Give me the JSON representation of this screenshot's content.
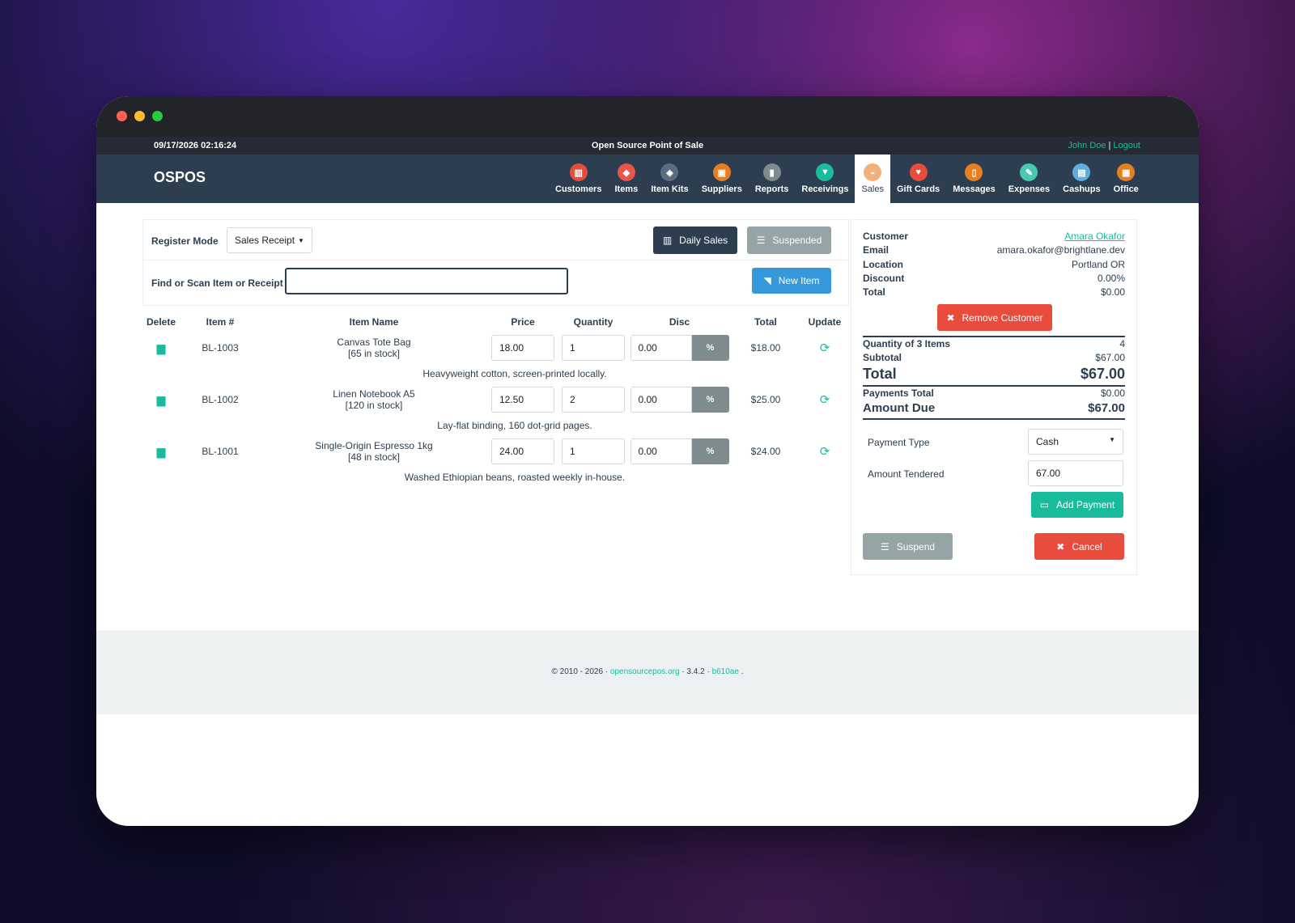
{
  "topbar": {
    "datetime": "09/17/2026 02:16:24",
    "app_title": "Open Source Point of Sale",
    "user": "John Doe",
    "separator": "|",
    "logout": "Logout"
  },
  "brand": "OSPOS",
  "nav": [
    {
      "label": "Customers",
      "icon": "customers-icon",
      "color": "#e74c3c"
    },
    {
      "label": "Items",
      "icon": "items-icon",
      "color": "#e8564a"
    },
    {
      "label": "Item Kits",
      "icon": "item-kits-icon",
      "color": "#5d6d7e"
    },
    {
      "label": "Suppliers",
      "icon": "suppliers-icon",
      "color": "#e67e22"
    },
    {
      "label": "Reports",
      "icon": "reports-icon",
      "color": "#7f8c8d"
    },
    {
      "label": "Receivings",
      "icon": "receivings-icon",
      "color": "#1abc9c"
    },
    {
      "label": "Sales",
      "icon": "sales-icon",
      "color": "#f0b27a"
    },
    {
      "label": "Gift Cards",
      "icon": "gift-cards-icon",
      "color": "#e74c3c"
    },
    {
      "label": "Messages",
      "icon": "messages-icon",
      "color": "#e67e22"
    },
    {
      "label": "Expenses",
      "icon": "expenses-icon",
      "color": "#48c9b0"
    },
    {
      "label": "Cashups",
      "icon": "cashups-icon",
      "color": "#5dade2"
    },
    {
      "label": "Office",
      "icon": "office-icon",
      "color": "#e67e22"
    }
  ],
  "register": {
    "mode_label": "Register Mode",
    "mode_value": "Sales Receipt",
    "daily_sales": "Daily Sales",
    "suspended": "Suspended",
    "find_label": "Find or Scan Item or Receipt",
    "find_value": "",
    "new_item": "New Item"
  },
  "table": {
    "headers": [
      "Delete",
      "Item #",
      "Item Name",
      "Price",
      "Quantity",
      "Disc",
      "Total",
      "Update"
    ],
    "discount_toggle": "%",
    "rows": [
      {
        "item_no": "BL-1003",
        "name": "Canvas Tote Bag",
        "stock": "[65 in stock]",
        "price": "18.00",
        "quantity": "1",
        "disc": "0.00",
        "total": "$18.00",
        "description": "Heavyweight cotton, screen-printed locally."
      },
      {
        "item_no": "BL-1002",
        "name": "Linen Notebook A5",
        "stock": "[120 in stock]",
        "price": "12.50",
        "quantity": "2",
        "disc": "0.00",
        "total": "$25.00",
        "description": "Lay-flat binding, 160 dot-grid pages."
      },
      {
        "item_no": "BL-1001",
        "name": "Single-Origin Espresso 1kg",
        "stock": "[48 in stock]",
        "price": "24.00",
        "quantity": "1",
        "disc": "0.00",
        "total": "$24.00",
        "description": "Washed Ethiopian beans, roasted weekly in-house."
      }
    ]
  },
  "customer": {
    "customer_label": "Customer",
    "customer_value": "Amara Okafor",
    "email_label": "Email",
    "email_value": "amara.okafor@brightlane.dev",
    "location_label": "Location",
    "location_value": "Portland OR",
    "discount_label": "Discount",
    "discount_value": "0.00%",
    "total_label": "Total",
    "total_value": "$0.00",
    "remove": "Remove Customer"
  },
  "summary": {
    "qty_label": "Quantity of 3 Items",
    "qty_value": "4",
    "subtotal_label": "Subtotal",
    "subtotal_value": "$67.00",
    "total_label": "Total",
    "total_value": "$67.00",
    "payments_label": "Payments Total",
    "payments_value": "$0.00",
    "due_label": "Amount Due",
    "due_value": "$67.00"
  },
  "payment": {
    "type_label": "Payment Type",
    "type_value": "Cash",
    "tendered_label": "Amount Tendered",
    "tendered_value": "67.00",
    "add_payment": "Add Payment",
    "suspend": "Suspend",
    "cancel": "Cancel"
  },
  "footer": {
    "prefix": "© 2010 - 2026 · ",
    "link": "opensourcepos.org",
    "version": " · 3.4.2 · ",
    "commit": "b610ae",
    "suffix": " ."
  }
}
